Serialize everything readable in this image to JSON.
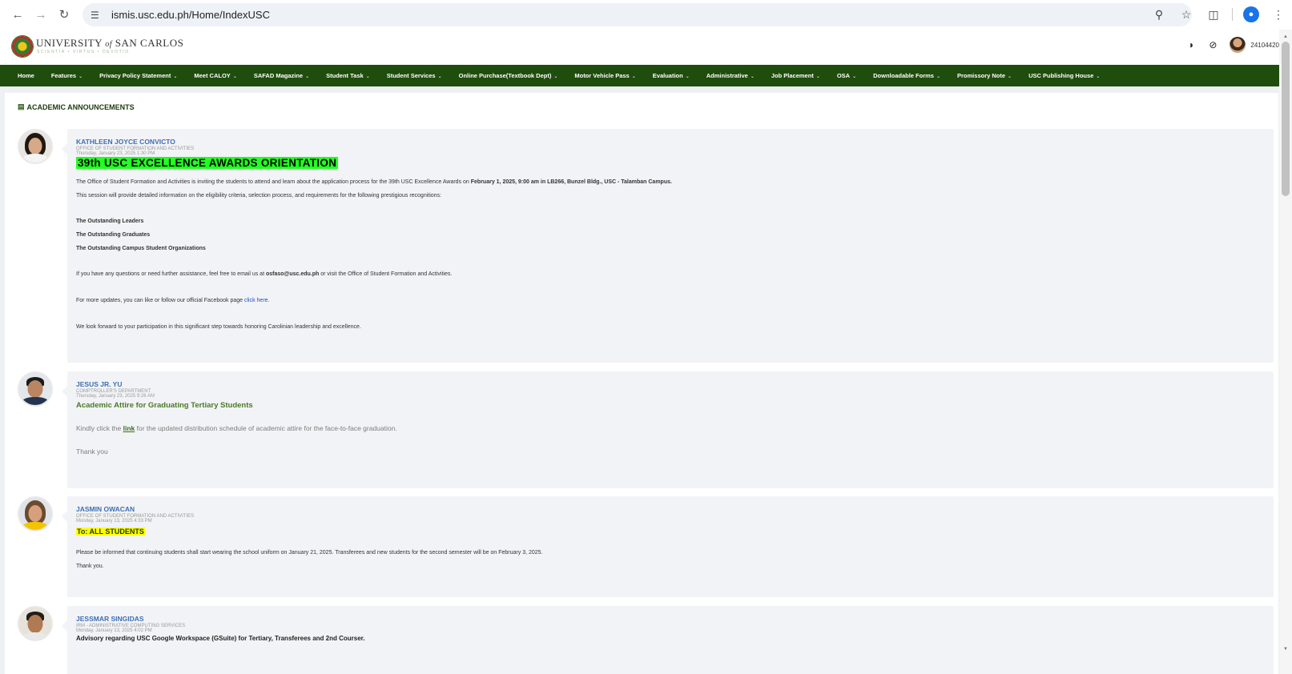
{
  "browser": {
    "url": "ismis.usc.edu.ph/Home/IndexUSC",
    "icons": [
      "back-arrow-icon",
      "forward-arrow-icon",
      "reload-icon",
      "site-settings-icon",
      "zoom-icon",
      "bookmark-star-icon",
      "extensions-icon",
      "profile-icon",
      "menu-icon"
    ]
  },
  "header": {
    "logo_main": "UNIVERSITY",
    "logo_of": "of",
    "logo_rest": "SAN CARLOS",
    "logo_tagline": "SCIENTIA • VIRTUS • DEVOTIO",
    "user_id": "24104420"
  },
  "menu": [
    {
      "label": "Home",
      "dropdown": false
    },
    {
      "label": "Features",
      "dropdown": true
    },
    {
      "label": "Privacy Policy Statement",
      "dropdown": true
    },
    {
      "label": "Meet CALOY",
      "dropdown": true
    },
    {
      "label": "SAFAD Magazine",
      "dropdown": true
    },
    {
      "label": "Student Task",
      "dropdown": true
    },
    {
      "label": "Student Services",
      "dropdown": true
    },
    {
      "label": "Online Purchase(Textbook Dept)",
      "dropdown": true
    },
    {
      "label": "Motor Vehicle Pass",
      "dropdown": true
    },
    {
      "label": "Evaluation",
      "dropdown": true
    },
    {
      "label": "Administrative",
      "dropdown": true
    },
    {
      "label": "Job Placement",
      "dropdown": true
    },
    {
      "label": "OSA",
      "dropdown": true
    },
    {
      "label": "Downloadable Forms",
      "dropdown": true
    },
    {
      "label": "Promissory Note",
      "dropdown": true
    },
    {
      "label": "USC Publishing House",
      "dropdown": true
    }
  ],
  "section_title": "ACADEMIC ANNOUNCEMENTS",
  "posts": [
    {
      "author": "KATHLEEN JOYCE CONVICTO",
      "department": "OFFICE OF STUDENT FORMATION AND ACTIVITIES",
      "date": "Thursday, January 23, 2025 1:30 PM",
      "title": "39th USC EXCELLENCE AWARDS ORIENTATION",
      "p1_pre": "The Office of Student Formation and Activities is inviting the students to attend and learn about the application process for the 39th USC Excellence Awards on ",
      "p1_bold": "February 1, 2025, 9:00 am in LB266, Bunzel Bldg., USC - Talamban Campus.",
      "p2": "This session will provide detailed information on the eligibility criteria, selection process, and requirements for the following prestigious recognitions:",
      "list": [
        "The Outstanding Leaders",
        "The Outstanding Graduates",
        "The Outstanding Campus Student Organizations"
      ],
      "p3_pre": "If you have any questions or need further assistance, feel free to email us at ",
      "p3_bold": "osfaso@usc.edu.ph",
      "p3_post": " or visit the Office of Student Formation and Activities.",
      "p4_pre": "For more updates, you can like or follow our official Facebook page ",
      "p4_link": "click here.",
      "p5": "We look forward to your participation in this significant step towards honoring Carolinian leadership and excellence."
    },
    {
      "author": "JESUS JR. YU",
      "department": "COMPTROLLER'S DEPARTMENT",
      "date": "Thursday, January 23, 2025 9:26 AM",
      "title": "Academic Attire for Graduating Tertiary Students",
      "p1_pre": "Kindly click the ",
      "p1_link": "link",
      "p1_post": " for the updated distribution schedule of academic attire for the face-to-face graduation.",
      "p2": "Thank you"
    },
    {
      "author": "JASMIN OWACAN",
      "department": "OFFICE OF STUDENT FORMATION AND ACTIVITIES",
      "date": "Monday, January 13, 2025 4:33 PM",
      "title": "To: ALL STUDENTS",
      "p1": "Please be informed that continuing students shall start wearing the school uniform on January 21, 2025.  Transferees and new students for the second semester will be on February 3, 2025.",
      "p2": "Thank you."
    },
    {
      "author": "JESSMAR SINGIDAS",
      "department": "IRM - ADMINISTRATIVE COMPUTING SERVICES",
      "date": "Monday, January 13, 2025 4:02 PM",
      "title": "Advisory regarding USC Google Workspace (GSuite) for Tertiary, Transferees and 2nd Courser."
    }
  ]
}
